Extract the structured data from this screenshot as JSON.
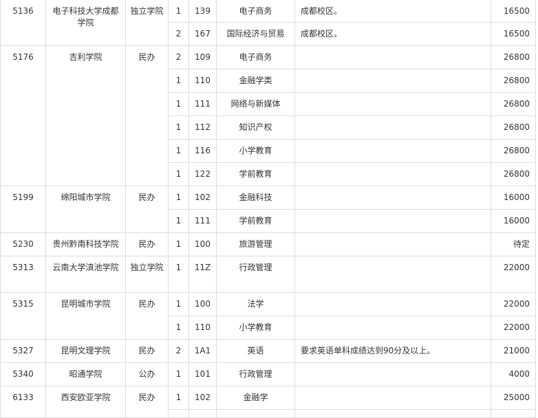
{
  "table": {
    "groups": [
      {
        "code": "5136",
        "name": "电子科技大学成都学院",
        "type": "独立学院",
        "rows": [
          {
            "count": "1",
            "major_code": "139",
            "major": "电子商务",
            "note": "成都校区。",
            "fee": "16500"
          },
          {
            "count": "2",
            "major_code": "167",
            "major": "国际经济与贸易",
            "note": "成都校区。",
            "fee": "16500"
          }
        ]
      },
      {
        "code": "5176",
        "name": "吉利学院",
        "type": "民办",
        "rows": [
          {
            "count": "2",
            "major_code": "109",
            "major": "电子商务",
            "note": "",
            "fee": "26800"
          },
          {
            "count": "1",
            "major_code": "110",
            "major": "金融学类",
            "note": "",
            "fee": "26800"
          },
          {
            "count": "1",
            "major_code": "111",
            "major": "网络与新媒体",
            "note": "",
            "fee": "26800"
          },
          {
            "count": "1",
            "major_code": "112",
            "major": "知识产权",
            "note": "",
            "fee": "26800"
          },
          {
            "count": "1",
            "major_code": "116",
            "major": "小学教育",
            "note": "",
            "fee": "26800"
          },
          {
            "count": "1",
            "major_code": "122",
            "major": "学前教育",
            "note": "",
            "fee": "26800"
          }
        ]
      },
      {
        "code": "5199",
        "name": "绵阳城市学院",
        "type": "民办",
        "rows": [
          {
            "count": "1",
            "major_code": "102",
            "major": "金融科技",
            "note": "",
            "fee": "16000"
          },
          {
            "count": "1",
            "major_code": "111",
            "major": "学前教育",
            "note": "",
            "fee": "16000"
          }
        ]
      },
      {
        "code": "5230",
        "name": "贵州黔南科技学院",
        "type": "民办",
        "rows": [
          {
            "count": "1",
            "major_code": "100",
            "major": "旅游管理",
            "note": "",
            "fee": "待定"
          }
        ]
      },
      {
        "code": "5313",
        "name": "云南大学滇池学院",
        "type": "独立学院",
        "rows": [
          {
            "count": "1",
            "major_code": "11Z",
            "major": "行政管理",
            "note": "",
            "fee": "22000"
          }
        ]
      },
      {
        "code": "5315",
        "name": "昆明城市学院",
        "type": "民办",
        "rows": [
          {
            "count": "1",
            "major_code": "100",
            "major": "法学",
            "note": "",
            "fee": "22000"
          },
          {
            "count": "1",
            "major_code": "110",
            "major": "小学教育",
            "note": "",
            "fee": "22000"
          }
        ]
      },
      {
        "code": "5327",
        "name": "昆明文理学院",
        "type": "民办",
        "rows": [
          {
            "count": "2",
            "major_code": "1A1",
            "major": "英语",
            "note": "要求英语单科成绩达到90分及以上。",
            "fee": "21000"
          }
        ]
      },
      {
        "code": "5340",
        "name": "昭通学院",
        "type": "公办",
        "rows": [
          {
            "count": "1",
            "major_code": "101",
            "major": "行政管理",
            "note": "",
            "fee": "4000"
          }
        ]
      },
      {
        "code": "6133",
        "name": "西安欧亚学院",
        "type": "民办",
        "rows": [
          {
            "count": "1",
            "major_code": "102",
            "major": "金融学",
            "note": "",
            "fee": "25000"
          },
          {
            "count": "",
            "major_code": "",
            "major": "",
            "note": "",
            "fee": ""
          }
        ]
      }
    ]
  }
}
